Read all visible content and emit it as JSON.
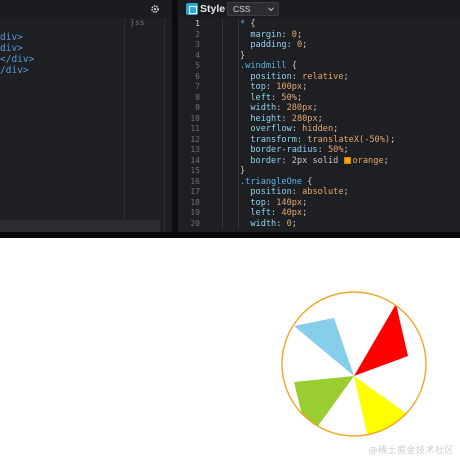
{
  "html_pane": {
    "tag_hint": "}ss",
    "lines": [
      "div>",
      "div>",
      "</div>",
      "/div>"
    ]
  },
  "css_pane": {
    "title": "Style",
    "language": "CSS",
    "language_options": [
      "CSS"
    ],
    "active_line": 1,
    "line_numbers": [
      "1",
      "2",
      "3",
      "4",
      "5",
      "6",
      "7",
      "8",
      "9",
      "10",
      "11",
      "12",
      "13",
      "14",
      "15",
      "16",
      "17",
      "18",
      "19",
      "20"
    ],
    "code": [
      [
        {
          "t": "* ",
          "c": "sel"
        },
        {
          "t": "{",
          "c": "punc"
        }
      ],
      [
        {
          "t": "  margin",
          "c": "prop"
        },
        {
          "t": ": ",
          "c": "punc"
        },
        {
          "t": "0",
          "c": "val"
        },
        {
          "t": ";",
          "c": "punc"
        }
      ],
      [
        {
          "t": "  padding",
          "c": "prop"
        },
        {
          "t": ": ",
          "c": "punc"
        },
        {
          "t": "0",
          "c": "val"
        },
        {
          "t": ";",
          "c": "punc"
        }
      ],
      [
        {
          "t": "}",
          "c": "punc"
        }
      ],
      [
        {
          "t": ".windmill ",
          "c": "sel"
        },
        {
          "t": "{",
          "c": "punc"
        }
      ],
      [
        {
          "t": "  position",
          "c": "prop"
        },
        {
          "t": ": ",
          "c": "punc"
        },
        {
          "t": "relative",
          "c": "val"
        },
        {
          "t": ";",
          "c": "punc"
        }
      ],
      [
        {
          "t": "  top",
          "c": "prop"
        },
        {
          "t": ": ",
          "c": "punc"
        },
        {
          "t": "100px",
          "c": "val"
        },
        {
          "t": ";",
          "c": "punc"
        }
      ],
      [
        {
          "t": "  left",
          "c": "prop"
        },
        {
          "t": ": ",
          "c": "punc"
        },
        {
          "t": "50%",
          "c": "val"
        },
        {
          "t": ";",
          "c": "punc"
        }
      ],
      [
        {
          "t": "  width",
          "c": "prop"
        },
        {
          "t": ": ",
          "c": "punc"
        },
        {
          "t": "280px",
          "c": "val"
        },
        {
          "t": ";",
          "c": "punc"
        }
      ],
      [
        {
          "t": "  height",
          "c": "prop"
        },
        {
          "t": ": ",
          "c": "punc"
        },
        {
          "t": "280px",
          "c": "val"
        },
        {
          "t": ";",
          "c": "punc"
        }
      ],
      [
        {
          "t": "  overflow",
          "c": "prop"
        },
        {
          "t": ": ",
          "c": "punc"
        },
        {
          "t": "hidden",
          "c": "val"
        },
        {
          "t": ";",
          "c": "punc"
        }
      ],
      [
        {
          "t": "  transform",
          "c": "prop"
        },
        {
          "t": ": ",
          "c": "punc"
        },
        {
          "t": "translateX(-50%)",
          "c": "val"
        },
        {
          "t": ";",
          "c": "punc"
        }
      ],
      [
        {
          "t": "  border-radius",
          "c": "prop"
        },
        {
          "t": ": ",
          "c": "punc"
        },
        {
          "t": "50%",
          "c": "val"
        },
        {
          "t": ";",
          "c": "punc"
        }
      ],
      [
        {
          "t": "  border",
          "c": "prop"
        },
        {
          "t": ": ",
          "c": "punc"
        },
        {
          "t": "2px solid ",
          "c": "kw"
        },
        {
          "t": "",
          "c": "chip"
        },
        {
          "t": "orange",
          "c": "val"
        },
        {
          "t": ";",
          "c": "punc"
        }
      ],
      [
        {
          "t": "}",
          "c": "punc"
        }
      ],
      [
        {
          "t": ".triangleOne ",
          "c": "sel"
        },
        {
          "t": "{",
          "c": "punc"
        }
      ],
      [
        {
          "t": "  position",
          "c": "prop"
        },
        {
          "t": ": ",
          "c": "punc"
        },
        {
          "t": "absolute",
          "c": "val"
        },
        {
          "t": ";",
          "c": "punc"
        }
      ],
      [
        {
          "t": "  top",
          "c": "prop"
        },
        {
          "t": ": ",
          "c": "punc"
        },
        {
          "t": "140px",
          "c": "val"
        },
        {
          "t": ";",
          "c": "punc"
        }
      ],
      [
        {
          "t": "  left",
          "c": "prop"
        },
        {
          "t": ": ",
          "c": "punc"
        },
        {
          "t": "40px",
          "c": "val"
        },
        {
          "t": ";",
          "c": "punc"
        }
      ],
      [
        {
          "t": "  width",
          "c": "prop"
        },
        {
          "t": ": ",
          "c": "punc"
        },
        {
          "t": "0",
          "c": "val"
        },
        {
          "t": ";",
          "c": "punc"
        }
      ]
    ]
  },
  "result": {
    "windmill": {
      "border_color": "#f5a623",
      "blades": [
        {
          "name": "blue-blade",
          "color": "#87ceeb"
        },
        {
          "name": "red-blade",
          "color": "#ff0000"
        },
        {
          "name": "yellow-blade",
          "color": "#ffff00"
        },
        {
          "name": "green-blade",
          "color": "#9acd32"
        }
      ]
    },
    "watermark": "@稀土掘金技术社区"
  },
  "icons": {
    "settings": "gear-icon",
    "style_badge": "style-icon",
    "dropdown": "chevron-down-icon"
  }
}
